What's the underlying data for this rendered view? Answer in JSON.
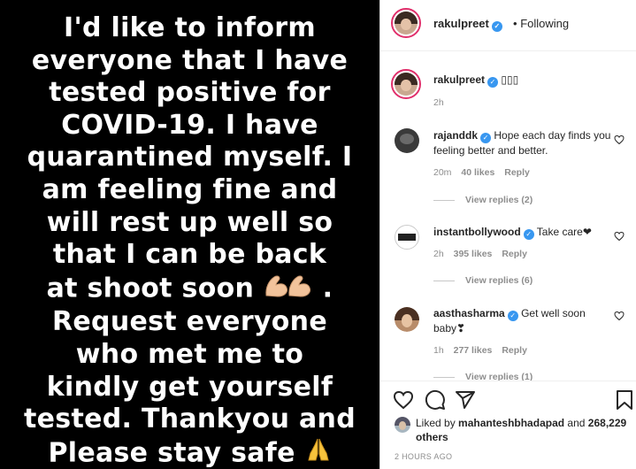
{
  "post": {
    "caption_lines": [
      "I'd like to inform",
      "everyone that I have",
      "tested positive for",
      "COVID-19. I have",
      "quarantined myself. I",
      "am feeling fine and",
      "will rest up well so",
      "that I can be back",
      "at shoot soon",
      "Request everyone",
      "who met me to",
      "kindly get yourself",
      "tested. Thankyou and",
      "Please stay safe"
    ],
    "line9_suffix": " .",
    "muscle_emoji": "💪💪",
    "pray_emoji": "🙏"
  },
  "header": {
    "username": "rakulpreet",
    "separator": "•",
    "follow_status": "Following"
  },
  "caption": {
    "username": "rakulpreet",
    "text": "▯▯▯",
    "time": "2h"
  },
  "comments": [
    {
      "username": "rajanddk",
      "text": "Hope each day finds you feeling better and better.",
      "time": "20m",
      "likes": "40 likes",
      "reply": "Reply",
      "view_replies": "View replies (2)"
    },
    {
      "username": "instantbollywood",
      "text": "Take care❤",
      "time": "2h",
      "likes": "395 likes",
      "reply": "Reply",
      "view_replies": "View replies (6)"
    },
    {
      "username": "aasthasharma",
      "text": "Get well soon baby❣",
      "time": "1h",
      "likes": "277 likes",
      "reply": "Reply",
      "view_replies": "View replies (1)"
    }
  ],
  "likes": {
    "prefix": "Liked by",
    "liker": "mahanteshbhadapad",
    "and": "and",
    "others": "268,229 others"
  },
  "timestamp": "2 HOURS AGO",
  "icons": {
    "verified": "verified-badge-icon",
    "heart": "heart-icon",
    "comment": "comment-icon",
    "share": "share-icon",
    "save": "bookmark-icon"
  },
  "colors": {
    "verified": "#3897f0",
    "muted": "#8e8e8e",
    "text": "#262626",
    "post_bg": "#000000"
  }
}
